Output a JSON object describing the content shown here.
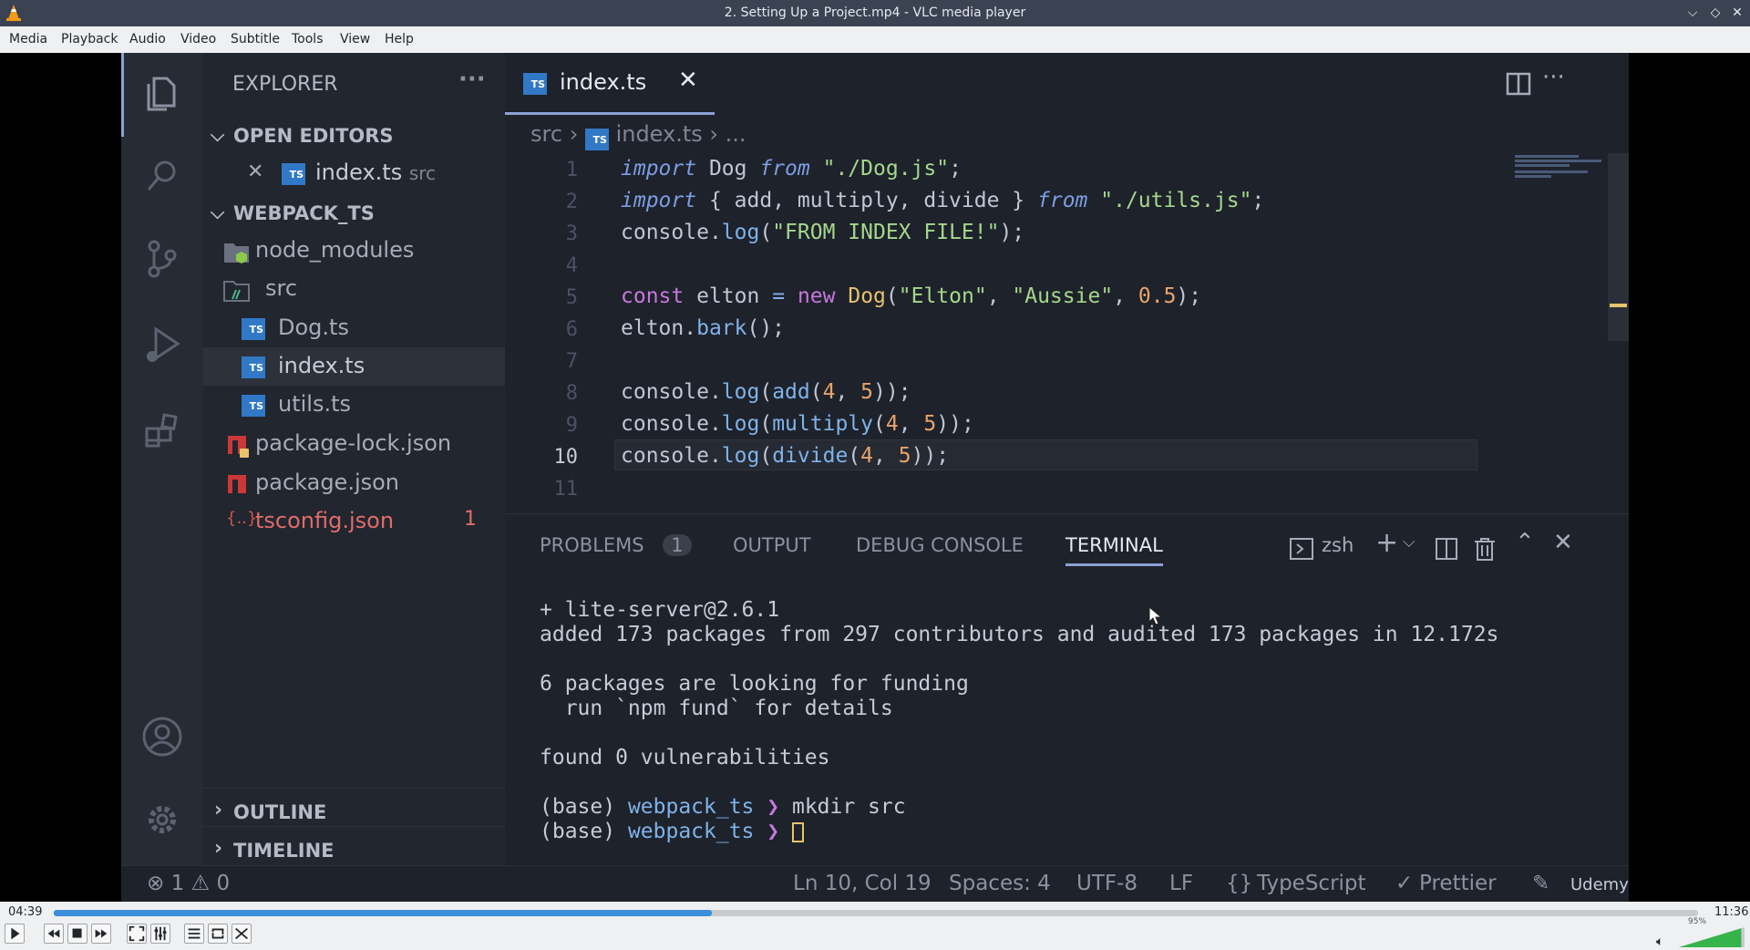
{
  "window": {
    "title": "2. Setting Up a Project.mp4 - VLC media player"
  },
  "menu": [
    "Media",
    "Playback",
    "Audio",
    "Video",
    "Subtitle",
    "Tools",
    "View",
    "Help"
  ],
  "explorer": {
    "title": "EXPLORER",
    "open_editors_header": "OPEN EDITORS",
    "open_editor_file": "index.ts",
    "open_editor_dir": "src",
    "workspace_header": "WEBPACK_TS",
    "tree": {
      "node_modules": "node_modules",
      "src": "src",
      "dog": "Dog.ts",
      "index": "index.ts",
      "utils": "utils.ts",
      "pkg_lock": "package-lock.json",
      "pkg": "package.json",
      "tsconfig": "tsconfig.json",
      "tsconfig_problems": "1"
    },
    "outline": "OUTLINE",
    "timeline": "TIMELINE"
  },
  "editor": {
    "tab_label": "index.ts",
    "breadcrumb": {
      "folder": "src",
      "file": "index.ts",
      "more": "..."
    },
    "line_numbers": [
      "1",
      "2",
      "3",
      "4",
      "5",
      "6",
      "7",
      "8",
      "9",
      "10",
      "11"
    ]
  },
  "panel": {
    "tabs": {
      "problems": "PROBLEMS",
      "problems_count": "1",
      "output": "OUTPUT",
      "debug": "DEBUG CONSOLE",
      "terminal": "TERMINAL"
    },
    "shell": "zsh",
    "terminal_lines": [
      "+ lite-server@2.6.1",
      "added 173 packages from 297 contributors and audited 173 packages in 12.172s",
      "",
      "6 packages are looking for funding",
      "  run `npm fund` for details",
      "",
      "found 0 vulnerabilities",
      ""
    ],
    "prompt_prefix": "(base) ",
    "prompt_dir": "webpack_ts",
    "prompt_arrow": " ❯ ",
    "prompt_cmd": "mkdir src"
  },
  "statusbar": {
    "errors": "1",
    "warnings": "0",
    "position": "Ln 10, Col 19",
    "spaces": "Spaces: 4",
    "encoding": "UTF-8",
    "eol": "LF",
    "language": "TypeScript",
    "formatter": "Prettier",
    "watermark": "Udemy"
  },
  "player": {
    "elapsed": "04:39",
    "total": "11:36",
    "progress": 0.4,
    "volume_label": "95%",
    "volume": 0.95
  }
}
